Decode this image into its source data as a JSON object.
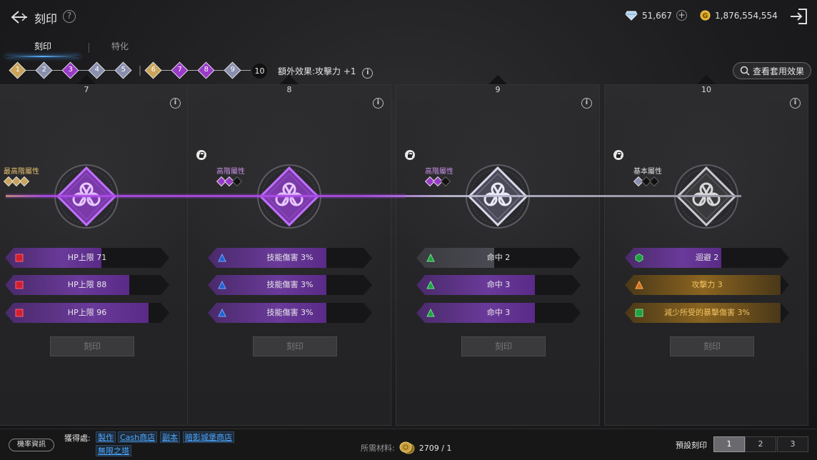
{
  "header": {
    "title": "刻印"
  },
  "currency": {
    "diamonds": "51,667",
    "gold": "1,876,554,554"
  },
  "tabs": [
    {
      "label": "刻印"
    },
    {
      "label": "特化"
    }
  ],
  "steps": [
    {
      "num": "1",
      "color": "#c9a45a"
    },
    {
      "num": "2",
      "color": "#8a8fae"
    },
    {
      "num": "3",
      "color": "#9a3ac8"
    },
    {
      "num": "4",
      "color": "#8a8fae"
    },
    {
      "num": "5",
      "color": "#8a8fae"
    },
    {
      "num": "6",
      "color": "#c9a45a"
    },
    {
      "num": "7",
      "color": "#9a3ac8"
    },
    {
      "num": "8",
      "color": "#9a3ac8"
    },
    {
      "num": "9",
      "color": "#8a8fae"
    },
    {
      "num": "10",
      "color": "#111111"
    }
  ],
  "bonus_effect": "額外效果:攻擊力 +1",
  "view_set_label": "查看套用效果",
  "panels": [
    {
      "num": "7",
      "tier": "最高階屬性",
      "tier_color": "#e8c070",
      "gem_colors": [
        "#c9a45a",
        "#c9a45a",
        "#c9a45a"
      ],
      "locked": false,
      "emblem": "purple",
      "stats": [
        {
          "text": "HP上限 71",
          "icon": "red-square-icon",
          "fill": 0.62,
          "style": "purple"
        },
        {
          "text": "HP上限 88",
          "icon": "red-square-icon",
          "fill": 0.8,
          "style": "purple"
        },
        {
          "text": "HP上限 96",
          "icon": "red-square-icon",
          "fill": 0.92,
          "style": "purple"
        }
      ],
      "button": "刻印"
    },
    {
      "num": "8",
      "tier": "高階屬性",
      "tier_color": "#c890e8",
      "gem_colors": [
        "#9a3ac8",
        "#9a3ac8",
        "#111111"
      ],
      "locked": true,
      "emblem": "purple",
      "stats": [
        {
          "text": "技能傷害 3%",
          "icon": "blue-triangle-icon",
          "fill": 0.76,
          "style": "purple"
        },
        {
          "text": "技能傷害 3%",
          "icon": "blue-triangle-icon",
          "fill": 0.76,
          "style": "purple"
        },
        {
          "text": "技能傷害 3%",
          "icon": "blue-triangle-icon",
          "fill": 0.76,
          "style": "purple"
        }
      ],
      "button": "刻印"
    },
    {
      "num": "9",
      "tier": "高階屬性",
      "tier_color": "#c890e8",
      "gem_colors": [
        "#9a3ac8",
        "#9a3ac8",
        "#111111"
      ],
      "locked": true,
      "emblem": "silver",
      "stats": [
        {
          "text": "命中 2",
          "icon": "green-triangle-icon",
          "fill": 0.5,
          "style": "gray"
        },
        {
          "text": "命中 3",
          "icon": "green-triangle-icon",
          "fill": 0.76,
          "style": "purple"
        },
        {
          "text": "命中 3",
          "icon": "green-triangle-icon",
          "fill": 0.76,
          "style": "purple"
        }
      ],
      "button": "刻印"
    },
    {
      "num": "10",
      "tier": "基本屬性",
      "tier_color": "#e0e0e0",
      "gem_colors": [
        "#8a8fae",
        "#111111",
        "#111111"
      ],
      "locked": true,
      "emblem": "silver-dark",
      "stats": [
        {
          "text": "迴避 2",
          "icon": "green-hexagon-icon",
          "fill": 0.62,
          "style": "purple"
        },
        {
          "text": "攻擊力 3",
          "icon": "orange-triangle-icon",
          "fill": 1.0,
          "style": "gold"
        },
        {
          "text": "減少所受的暴擊傷害 3%",
          "icon": "green-square-icon",
          "fill": 1.0,
          "style": "gold"
        }
      ],
      "button": "刻印"
    }
  ],
  "footer": {
    "prob_label": "機率資訊",
    "obtain_label": "獲得處:",
    "obtain_links": [
      "製作",
      "Cash商店",
      "副本",
      "暗影城堡商店",
      "無限之塔"
    ],
    "material_label": "所需材料:",
    "material_count": "2709 / 1",
    "preset_label": "預設刻印",
    "presets": [
      "1",
      "2",
      "3"
    ],
    "active_preset": "1"
  }
}
